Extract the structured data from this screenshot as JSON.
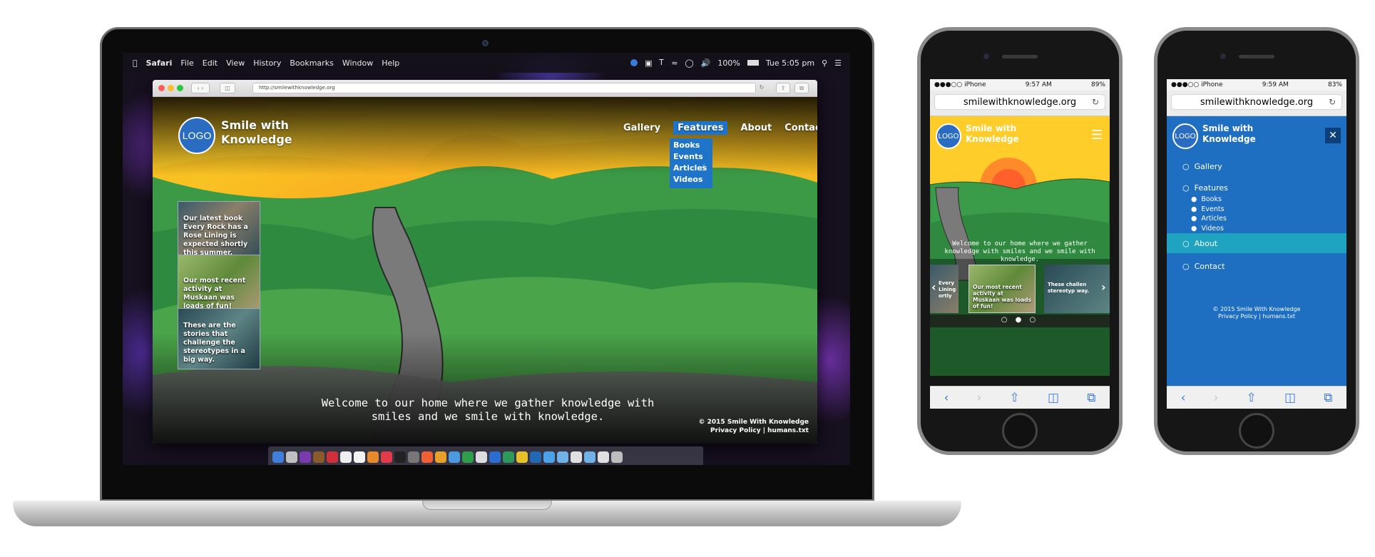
{
  "macos": {
    "menu": [
      "Safari",
      "File",
      "Edit",
      "View",
      "History",
      "Bookmarks",
      "Window",
      "Help"
    ],
    "battery": "100%",
    "clock": "Tue 5:05 pm"
  },
  "safari": {
    "url": "http://smilewithknowledge.org"
  },
  "site": {
    "logo": "LOGO",
    "brand": "Smile with Knowledge",
    "nav": [
      "Gallery",
      "Features",
      "About",
      "Contact"
    ],
    "features_dropdown": [
      "Books",
      "Events",
      "Articles",
      "Videos"
    ],
    "cards": [
      "Our latest book Every Rock has a Rose Lining is expected shortly this summer.",
      "Our most recent activity at Muskaan was loads of fun!",
      "These are the stories that challenge the stereotypes in a big way."
    ],
    "welcome": "Welcome to our home where we gather knowledge with smiles and we smile with knowledge.",
    "copyright": "© 2015 Smile With Knowledge",
    "footer_links": "Privacy Policy | humans.txt"
  },
  "phone1": {
    "carrier": "●●●○○ iPhone",
    "time": "9:57 AM",
    "battery": "89%",
    "url": "smilewithknowledge.org",
    "partial_prev": "Every Lining ortly",
    "partial_next": "These challen stereotyp way.",
    "dots": "○ ● ○"
  },
  "phone2": {
    "carrier": "●●●○○ iPhone",
    "time": "9:59 AM",
    "battery": "83%",
    "url": "smilewithknowledge.org",
    "active_item": "About"
  },
  "colors": {
    "brand_blue": "#1e6fc2",
    "active_teal": "#1ea3c0"
  },
  "icons": [
    "apple-icon",
    "wifi-icon",
    "search-icon",
    "hamburger-menu-icon",
    "close-icon",
    "reload-icon",
    "share-icon",
    "bookmarks-icon",
    "tabs-icon"
  ]
}
